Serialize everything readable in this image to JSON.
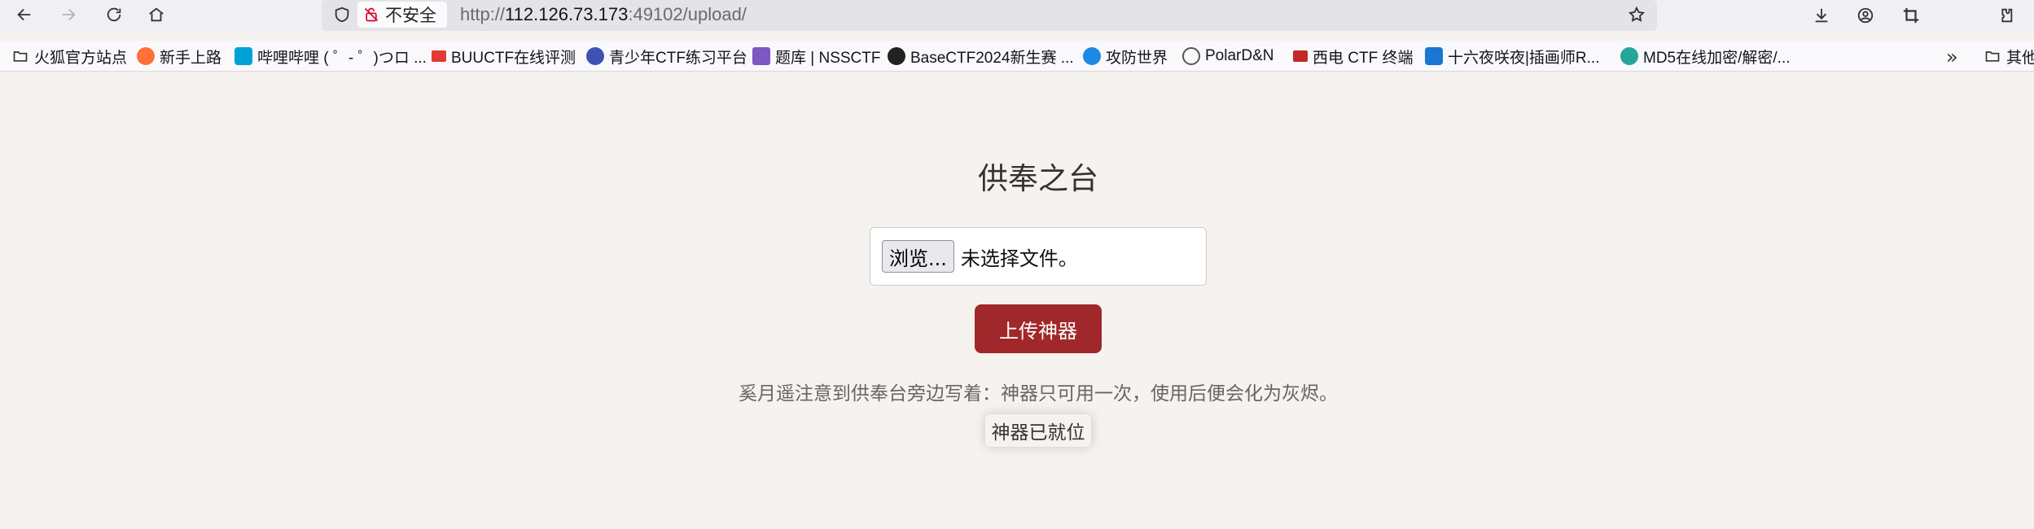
{
  "browser": {
    "security_label": "不安全",
    "url_prefix": "http://",
    "url_host": "112.126.73.173",
    "url_rest": ":49102/upload/"
  },
  "bookmarks": [
    {
      "label": "火狐官方站点",
      "icon": "folder-icon"
    },
    {
      "label": "新手上路",
      "icon": "firefox-icon",
      "color": "#ff7139"
    },
    {
      "label": "哔哩哔哩 ( ゜- ゜)つロ ...",
      "icon": "bilibili-icon",
      "color": "#00a1d6"
    },
    {
      "label": "BUUCTF在线评测",
      "icon": "buuctf-icon",
      "color": "#e53935"
    },
    {
      "label": "青少年CTF练习平台",
      "icon": "qsnctf-icon",
      "color": "#3f51b5"
    },
    {
      "label": "题库 | NSSCTF",
      "icon": "nssctf-icon",
      "color": "#7e57c2"
    },
    {
      "label": "BaseCTF2024新生赛 ...",
      "icon": "basectf-icon",
      "color": "#222222"
    },
    {
      "label": "攻防世界",
      "icon": "adworld-icon",
      "color": "#1e88e5"
    },
    {
      "label": "PolarD&N",
      "icon": "globe-icon",
      "color": "#555555"
    },
    {
      "label": "西电 CTF 终端",
      "icon": "xidian-icon",
      "color": "#c62828"
    },
    {
      "label": "十六夜咲夜|插画师R...",
      "icon": "bing-icon",
      "color": "#1976d2"
    },
    {
      "label": "MD5在线加密/解密/...",
      "icon": "md5-icon",
      "color": "#26a69a"
    },
    {
      "label": "其他",
      "icon": "folder-icon"
    }
  ],
  "page": {
    "title": "供奉之台",
    "browse_label": "浏览...",
    "file_status": "未选择文件。",
    "upload_label": "上传神器",
    "hint": "奚月遥注意到供奉台旁边写着：神器只可用一次，使用后便会化为灰烬。",
    "status": "神器已就位"
  }
}
